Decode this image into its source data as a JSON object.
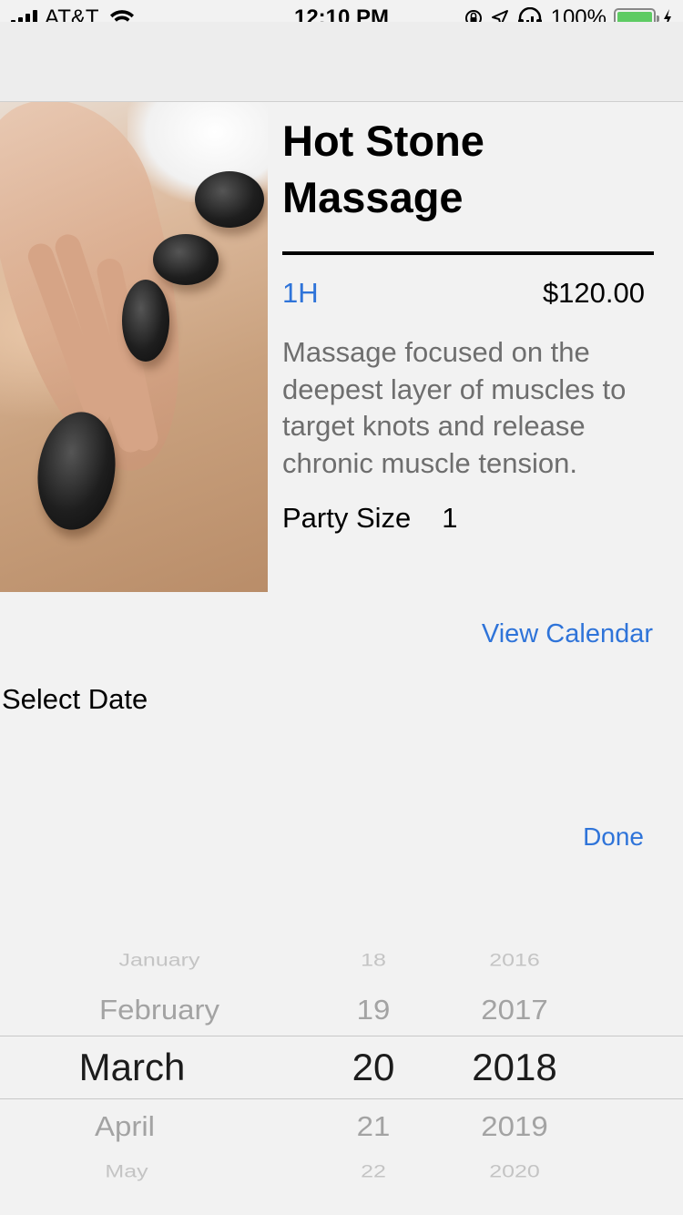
{
  "status_bar": {
    "carrier": "AT&T",
    "time": "12:10 PM",
    "battery_percent": "100%",
    "battery_level": 1.0
  },
  "service": {
    "image_icon": "hot-stone-massage-photo",
    "title": "Hot Stone Massage",
    "duration": "1H",
    "price": "$120.00",
    "description": "Massage focused on the deepest layer of muscles to target knots and release chronic muscle tension.",
    "party_size_label": "Party Size",
    "party_size_value": "1"
  },
  "actions": {
    "view_calendar": "View Calendar",
    "select_date": "Select Date",
    "done": "Done"
  },
  "date_picker": {
    "months": [
      "January",
      "February",
      "March",
      "April",
      "May"
    ],
    "days": [
      "18",
      "19",
      "20",
      "21",
      "22"
    ],
    "years": [
      "2016",
      "2017",
      "2018",
      "2019",
      "2020"
    ],
    "selected": {
      "month": "March",
      "day": "20",
      "year": "2018"
    }
  },
  "colors": {
    "accent": "#2f74d9",
    "background": "#f2f2f2",
    "battery_fill": "#5ecb63"
  }
}
